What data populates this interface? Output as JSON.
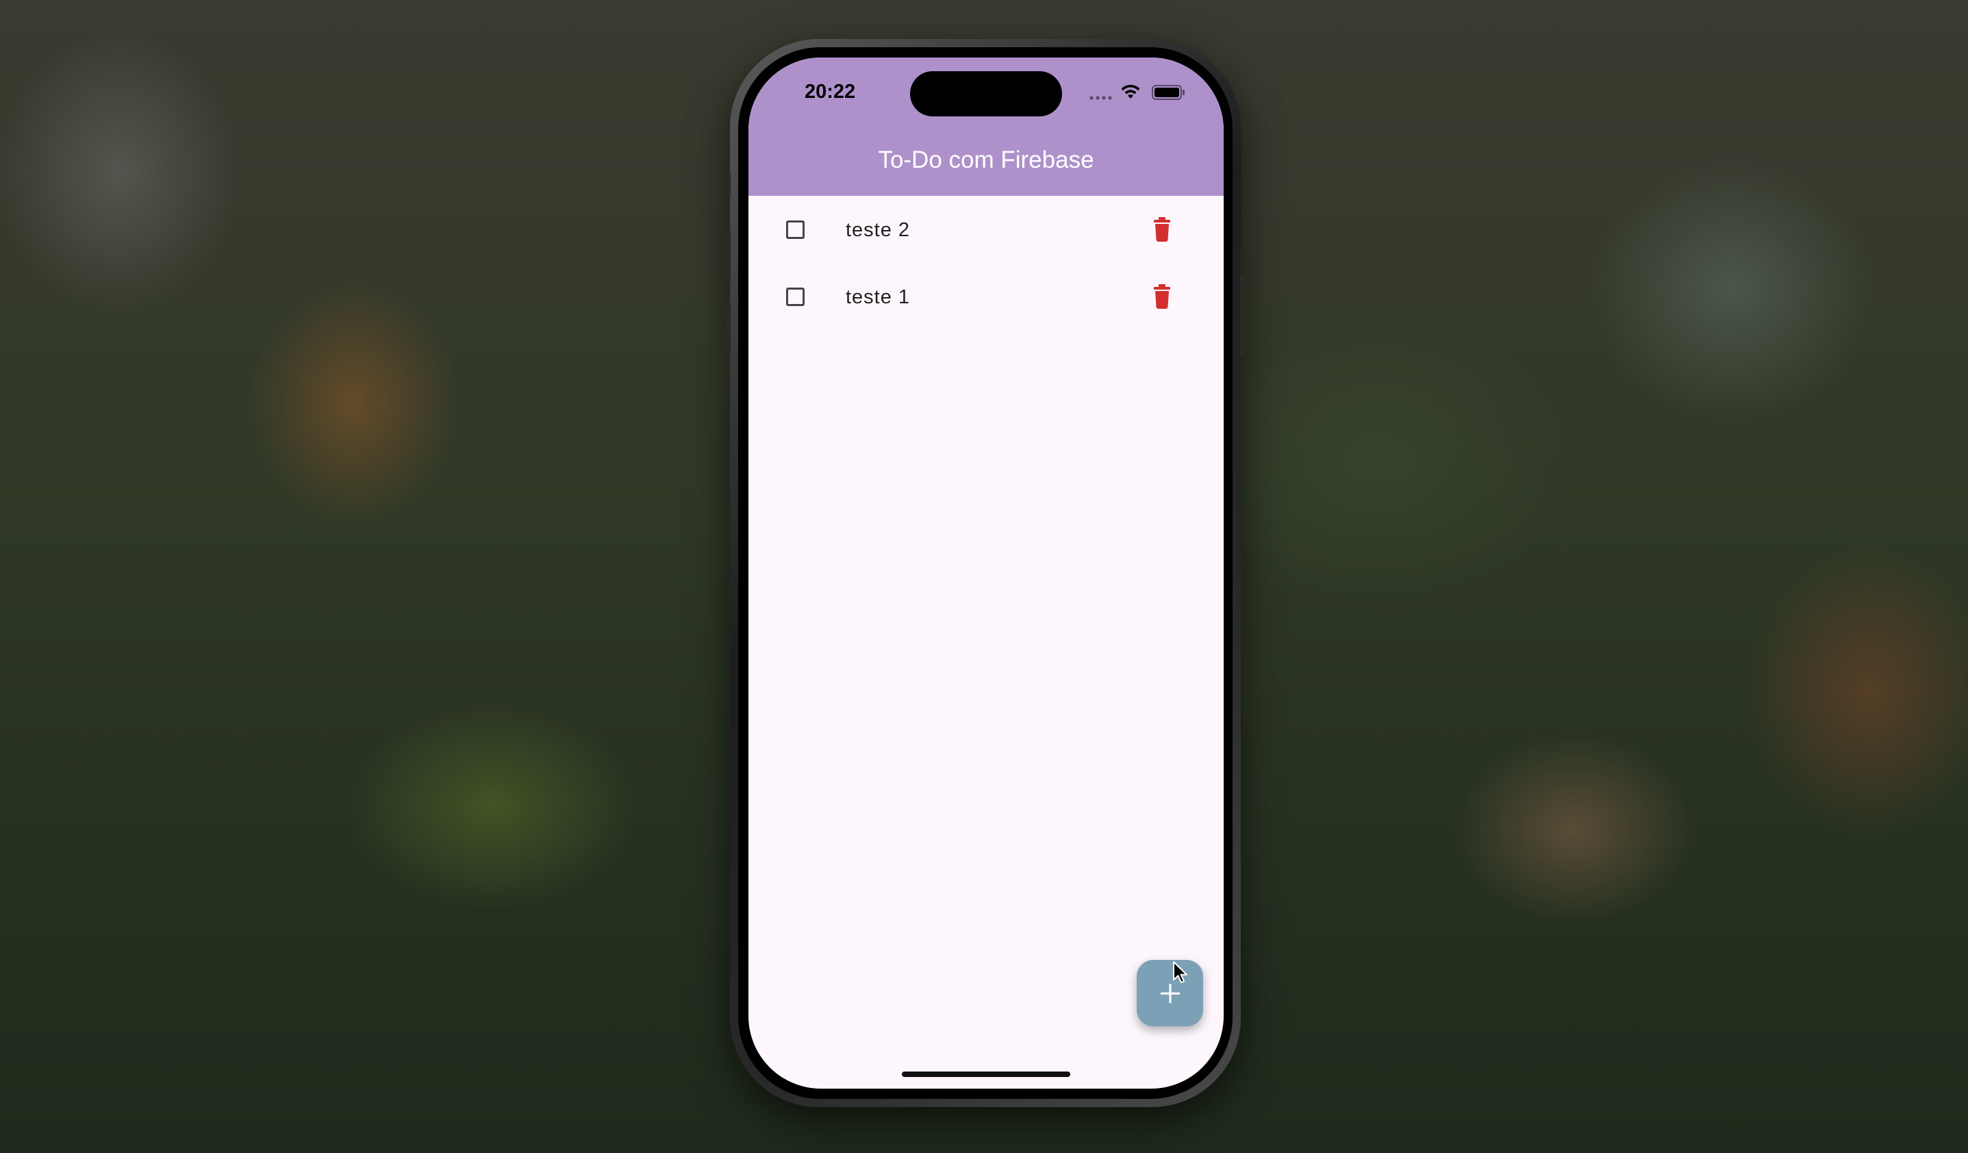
{
  "status_bar": {
    "time": "20:22"
  },
  "app_bar": {
    "title": "To-Do com Firebase",
    "color": "#ae91cb"
  },
  "todos": [
    {
      "label": "teste 2",
      "checked": false
    },
    {
      "label": "teste 1",
      "checked": false
    }
  ],
  "icons": {
    "checkbox": "checkbox-unchecked-icon",
    "delete": "trash-icon",
    "fab": "plus-icon",
    "wifi": "wifi-icon",
    "battery": "battery-icon",
    "signal": "signal-icon"
  },
  "colors": {
    "screen_background": "#fdf7fd",
    "delete_icon": "#d32f2f",
    "fab_background": "#7ca1b6"
  }
}
